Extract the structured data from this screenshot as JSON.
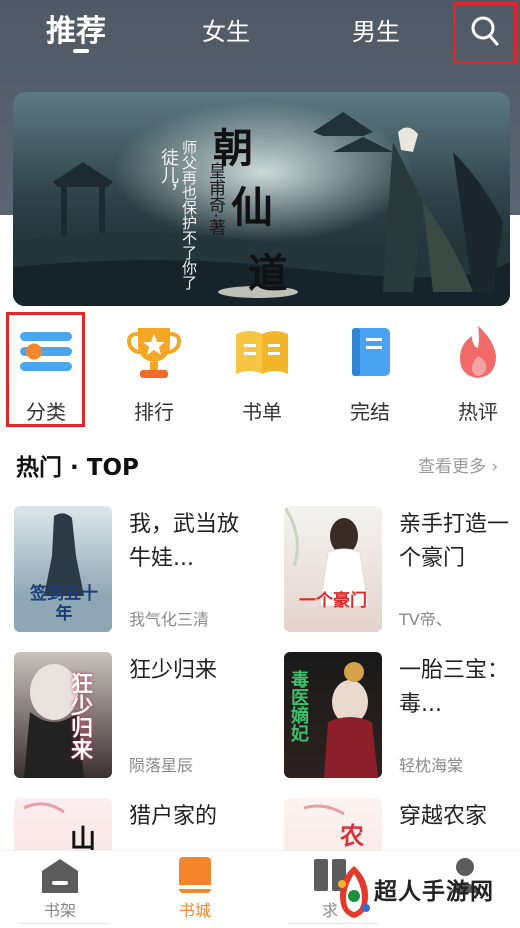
{
  "topnav": {
    "tabs": [
      {
        "label": "推荐"
      },
      {
        "label": "女生"
      },
      {
        "label": "男生"
      }
    ]
  },
  "banner": {
    "title": "朝仙道",
    "author_line": "皇甫奇·著",
    "quote_1": "徒儿，",
    "quote_2": "师父再也保护不了你了"
  },
  "categories": [
    {
      "label": "分类",
      "icon": "menu-icon",
      "color": "#4ba6f0"
    },
    {
      "label": "排行",
      "icon": "trophy-icon",
      "color": "#f5a623"
    },
    {
      "label": "书单",
      "icon": "open-book-icon",
      "color": "#f6c543"
    },
    {
      "label": "完结",
      "icon": "book-icon",
      "color": "#4aa3f2"
    },
    {
      "label": "热评",
      "icon": "flame-icon",
      "color": "#f06a6a"
    }
  ],
  "hot_section": {
    "title": "热门 · TOP",
    "more": "查看更多 ›"
  },
  "books": [
    {
      "title": "我，武当放牛娃...",
      "author": "我气化三清",
      "cover_text": "签到五十年"
    },
    {
      "title": "亲手打造一个豪门",
      "author": "TV帝、",
      "cover_text": "一个豪门"
    },
    {
      "title": "狂少归来",
      "author": "陨落星辰",
      "cover_text": "狂少归来"
    },
    {
      "title": "一胎三宝：毒...",
      "author": "轻枕海棠",
      "cover_text": "毒医嫡妃"
    },
    {
      "title": "猎户家的",
      "author": "",
      "cover_text": ""
    },
    {
      "title": "穿越农家",
      "author": "",
      "cover_text": ""
    }
  ],
  "bottom_nav": [
    {
      "label": "书架",
      "icon": "shelf-icon"
    },
    {
      "label": "书城",
      "icon": "bookstore-icon",
      "active": true
    },
    {
      "label": "求",
      "icon": "request-icon"
    },
    {
      "label": "",
      "icon": "profile-icon"
    }
  ],
  "watermark": {
    "text": "超人手游网"
  },
  "colors": {
    "accent": "#f5862b",
    "highlight_box": "#e2242c"
  }
}
